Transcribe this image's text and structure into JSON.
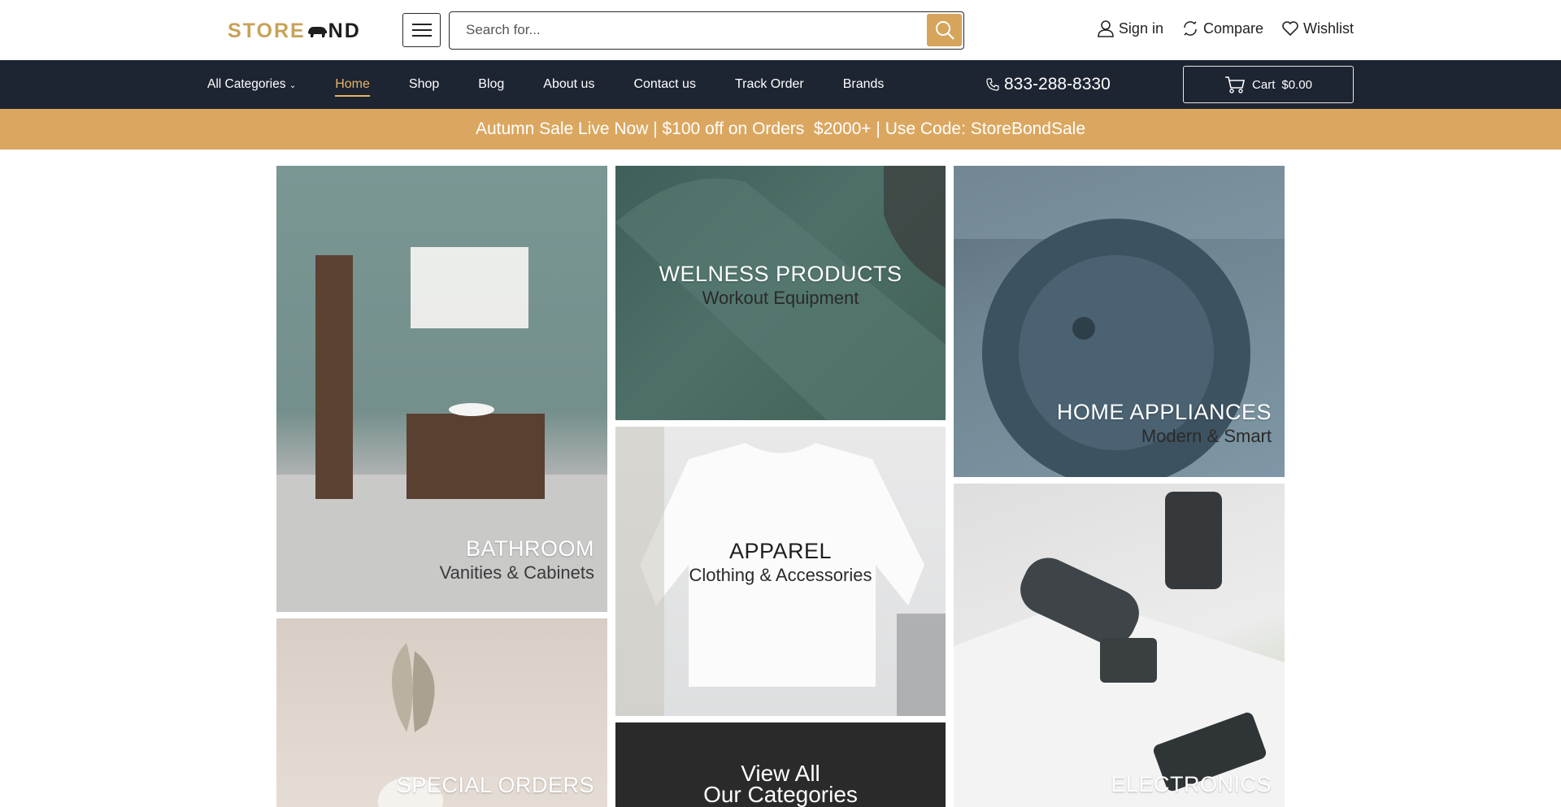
{
  "header": {
    "logo_left": "STORE",
    "logo_right": "ND",
    "search_placeholder": "Search for...",
    "links": [
      {
        "label": "Sign in",
        "icon": "user-icon"
      },
      {
        "label": "Compare",
        "icon": "compare-icon"
      },
      {
        "label": "Wishlist",
        "icon": "heart-icon"
      }
    ]
  },
  "nav": {
    "categories_label": "All Categories",
    "items": [
      "Home",
      "Shop",
      "Blog",
      "About us",
      "Contact us",
      "Track Order",
      "Brands"
    ],
    "active": "Home",
    "phone": "833-288-8330",
    "cart_label": "Cart",
    "cart_total": "$0.00"
  },
  "promo": {
    "text": "Autumn Sale Live Now | $100 off on Orders  $2000+ | Use Code: StoreBondSale"
  },
  "tiles": {
    "bathroom": {
      "title": "BATHROOM",
      "subtitle": "Vanities & Cabinets"
    },
    "wellness": {
      "title": "WELNESS PRODUCTS",
      "subtitle": "Workout Equipment"
    },
    "home": {
      "title": "HOME APPLIANCES",
      "subtitle": "Modern & Smart"
    },
    "apparel": {
      "title": "APPAREL",
      "subtitle": "Clothing & Accessories"
    },
    "electronics": {
      "title": "ELECTRONICS"
    },
    "special": {
      "title": "SPECIAL ORDERS"
    },
    "viewall": {
      "line1": "View All",
      "line2": "Our Categories"
    }
  },
  "colors": {
    "accent": "#dba760",
    "nav_bg": "#1d2432",
    "active_nav": "#e6b467"
  }
}
